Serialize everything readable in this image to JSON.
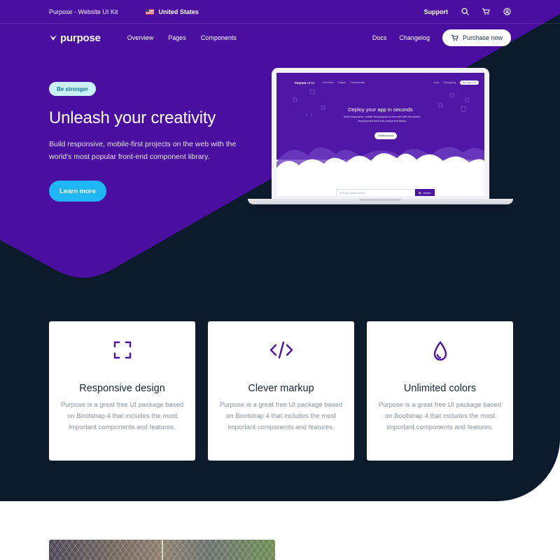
{
  "colors": {
    "purple": "#4a0fa0",
    "dark_navy": "#0c1b2b",
    "accent_cyan": "#1fb6f5",
    "badge_bg": "#cbf1fb",
    "icon_purple": "#4c12a4"
  },
  "topbar": {
    "kit_name": "Purpose - Website UI Kit",
    "country": "United States",
    "support_label": "Support",
    "icons": [
      "flag-us-icon",
      "search-icon",
      "cart-icon",
      "user-circle-icon"
    ]
  },
  "nav": {
    "brand": "purpose",
    "links": [
      "Overview",
      "Pages",
      "Components"
    ],
    "right_links": [
      "Docs",
      "Changelog"
    ],
    "purchase_label": "Purchase now"
  },
  "hero": {
    "badge": "Be stronger",
    "title": "Unleash your creativity",
    "description": "Build responsive, mobile-first projects on the web with the world's most popular front-end component library.",
    "cta": "Learn more"
  },
  "mockup": {
    "brand": "Purpose",
    "brand_suffix": "UI Kit",
    "links": [
      "Overview",
      "Pages",
      "Components"
    ],
    "right_links": [
      "Docs",
      "Changelog"
    ],
    "purchase_label": "Purchase now",
    "title": "Deploy your app in seconds",
    "description": "Build responsive, mobile-first projects on the web with the world's most popular front-end component library.",
    "cta": "Create account",
    "search_placeholder": "Find your dream domain",
    "search_button": "Search"
  },
  "features": [
    {
      "icon": "expand-icon",
      "title": "Responsive design",
      "description": "Purpose is a great free UI package based on Bootstrap 4 that includes the most important components and features."
    },
    {
      "icon": "code-icon",
      "title": "Clever markup",
      "description": "Purpose is a great free UI package based on Bootstrap 4 that includes the most important components and features."
    },
    {
      "icon": "droplet-icon",
      "title": "Unlimited colors",
      "description": "Purpose is a great free UI package based on Bootstrap 4 that includes the most important components and features."
    }
  ]
}
